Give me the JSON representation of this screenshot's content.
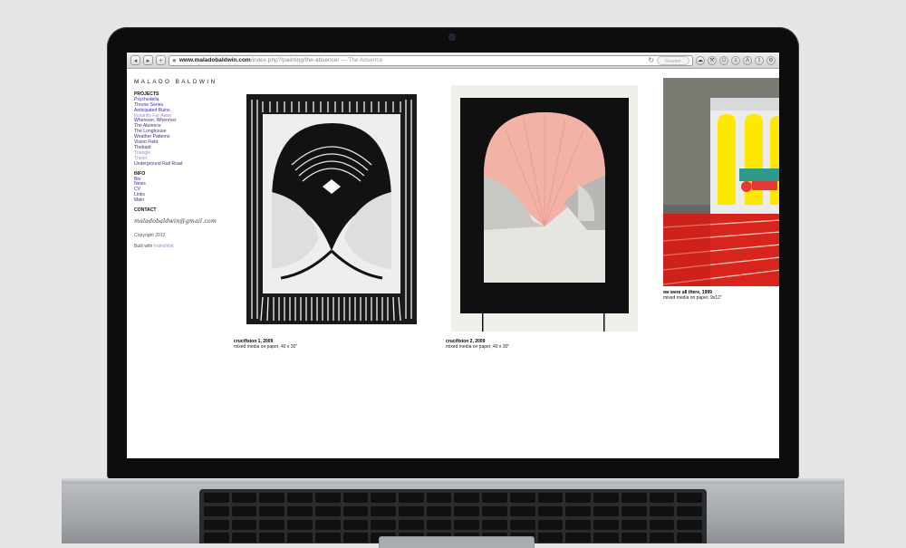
{
  "browser": {
    "url_domain": "www.maladobaldwin.com",
    "url_path": "/index.php?/painting/the-absence/",
    "page_title": "— The Absence",
    "reader_label": "Reader",
    "back_glyph": "◂",
    "forward_glyph": "▸",
    "add_glyph": "+"
  },
  "site": {
    "title": "MALADO BALDWIN",
    "projects_heading": "PROJECTS",
    "projects": [
      {
        "label": "Psychedelia",
        "visited": false
      },
      {
        "label": "Throne Series",
        "visited": false
      },
      {
        "label": "Anticipated Ruins",
        "visited": false
      },
      {
        "label": "Instantly Far Away",
        "visited": true
      },
      {
        "label": "Wherever, Wherever",
        "visited": false
      },
      {
        "label": "The Absence",
        "visited": false
      },
      {
        "label": "The Longhouse",
        "visited": false
      },
      {
        "label": "Weather Patterns",
        "visited": false
      },
      {
        "label": "Vision Field",
        "visited": false
      },
      {
        "label": "Thebaid",
        "visited": false
      },
      {
        "label": "Triangle",
        "visited": true
      },
      {
        "label": "Travel",
        "visited": true
      },
      {
        "label": "Underground Rail Road",
        "visited": false
      }
    ],
    "info_heading": "INFO",
    "info": [
      {
        "label": "Bio"
      },
      {
        "label": "News"
      },
      {
        "label": "CV"
      },
      {
        "label": "Links"
      },
      {
        "label": "Main"
      }
    ],
    "contact_heading": "CONTACT",
    "email": "maladobaldwin@gmail.com",
    "copyright": "Copyright 2012",
    "built_with": "Built with",
    "built_link": "Indexhibit"
  },
  "artworks": [
    {
      "title": "crucifixion 1, 2009",
      "medium": "mixed media on paper, 40 x 30\""
    },
    {
      "title": "crucifixion 2, 2009",
      "medium": "mixed media on paper, 40 x 30\""
    },
    {
      "title": "we were all there, 1999",
      "medium": "mixed media on paper, 9x12\""
    }
  ],
  "colors": {
    "link": "#3b2aa8",
    "link_visited": "#9c8ad9",
    "salmon": "#f3b2a6",
    "red_floor": "#d9241c",
    "yellow": "#ffe800"
  }
}
